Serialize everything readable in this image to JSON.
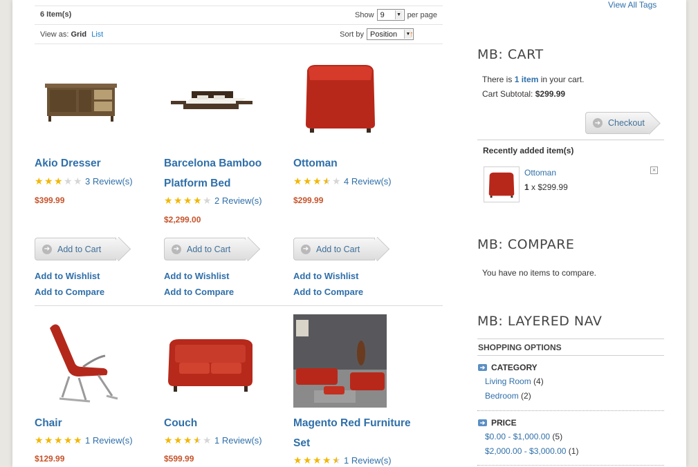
{
  "toolbar": {
    "item_count": "6 Item(s)",
    "show_label": "Show",
    "per_page_value": "9",
    "per_page_suffix": "per page",
    "view_as_label": "View as:",
    "view_grid": "Grid",
    "view_list": "List",
    "sort_by_label": "Sort by",
    "sort_value": "Position",
    "sort_direction_icon": "sort-ascending-arrow"
  },
  "products": [
    {
      "name_line1": "Akio Dresser",
      "name_line2": "",
      "stars": 3,
      "reviews": "3 Review(s)",
      "price": "$399.99"
    },
    {
      "name_line1": "Barcelona Bamboo",
      "name_line2": "Platform Bed",
      "stars": 4,
      "reviews": "2 Review(s)",
      "price": "$2,299.00"
    },
    {
      "name_line1": "Ottoman",
      "name_line2": "",
      "stars": 3.5,
      "reviews": "4 Review(s)",
      "price": "$299.99"
    },
    {
      "name_line1": "Chair",
      "name_line2": "",
      "stars": 5,
      "reviews": "1 Review(s)",
      "price": "$129.99"
    },
    {
      "name_line1": "Couch",
      "name_line2": "",
      "stars": 3.5,
      "reviews": "1 Review(s)",
      "price": "$599.99"
    },
    {
      "name_line1": "Magento Red Furniture",
      "name_line2": "Set",
      "stars": 4.5,
      "reviews": "1 Review(s)",
      "price": ""
    }
  ],
  "actions": {
    "add_to_cart": "Add to Cart",
    "add_to_wishlist": "Add to Wishlist",
    "add_to_compare": "Add to Compare"
  },
  "sidebar": {
    "view_all_tags": "View All Tags",
    "cart": {
      "title": "MB: CART",
      "there_is": "There is",
      "item_link": "1 item",
      "in_your_cart": "in your cart.",
      "subtotal_label": "Cart Subtotal:",
      "subtotal_value": "$299.99",
      "checkout": "Checkout",
      "recent_title": "Recently added item(s)",
      "recent_item_name": "Ottoman",
      "recent_item_qty": "1",
      "recent_item_times": "x",
      "recent_item_price": "$299.99"
    },
    "compare": {
      "title": "MB: COMPARE",
      "empty_text": "You have no items to compare."
    },
    "layered": {
      "title": "MB: LAYERED NAV",
      "shopping_options": "SHOPPING OPTIONS",
      "category_title": "CATEGORY",
      "categories": [
        {
          "label": "Living Room",
          "count": "(4)"
        },
        {
          "label": "Bedroom",
          "count": "(2)"
        }
      ],
      "price_title": "PRICE",
      "prices": [
        {
          "label": "$0.00 - $1,000.00",
          "count": "(5)"
        },
        {
          "label": "$2,000.00 - $3,000.00",
          "count": "(1)"
        }
      ]
    }
  },
  "colors": {
    "link": "#2f6fa9",
    "price": "#c7532a",
    "star": "#f2b705",
    "furniture_red": "#c0281c"
  }
}
